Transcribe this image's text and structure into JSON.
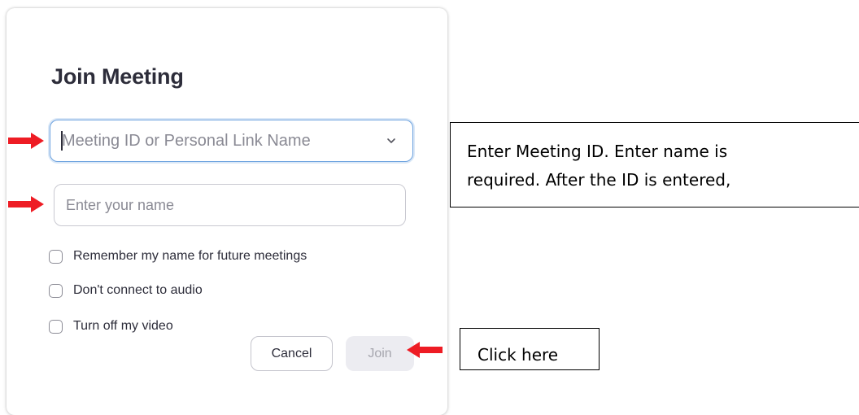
{
  "dialog": {
    "title": "Join Meeting",
    "meeting_field": {
      "placeholder": "Meeting ID or Personal Link Name",
      "value": "",
      "dropdown_icon": "chevron-down-icon"
    },
    "name_field": {
      "placeholder": "Enter your name",
      "value": ""
    },
    "options": [
      {
        "label": "Remember my name for future meetings",
        "checked": false
      },
      {
        "label": "Don't connect to audio",
        "checked": false
      },
      {
        "label": "Turn off my video",
        "checked": false
      }
    ],
    "buttons": {
      "cancel_label": "Cancel",
      "join_label": "Join",
      "join_enabled": false
    }
  },
  "annotations": {
    "arrow_color": "#ee1c24",
    "arrow_icon": "arrow-right-icon",
    "callout_id_lines": [
      "Enter Meeting ID.  Enter name is",
      "required. After the ID is entered,"
    ],
    "callout_click": "Click here"
  },
  "colors": {
    "title": "#2d2d3a",
    "focus_border": "#6ea3df",
    "join_disabled_bg": "#ececf1",
    "join_disabled_text": "#a6a6ae"
  }
}
